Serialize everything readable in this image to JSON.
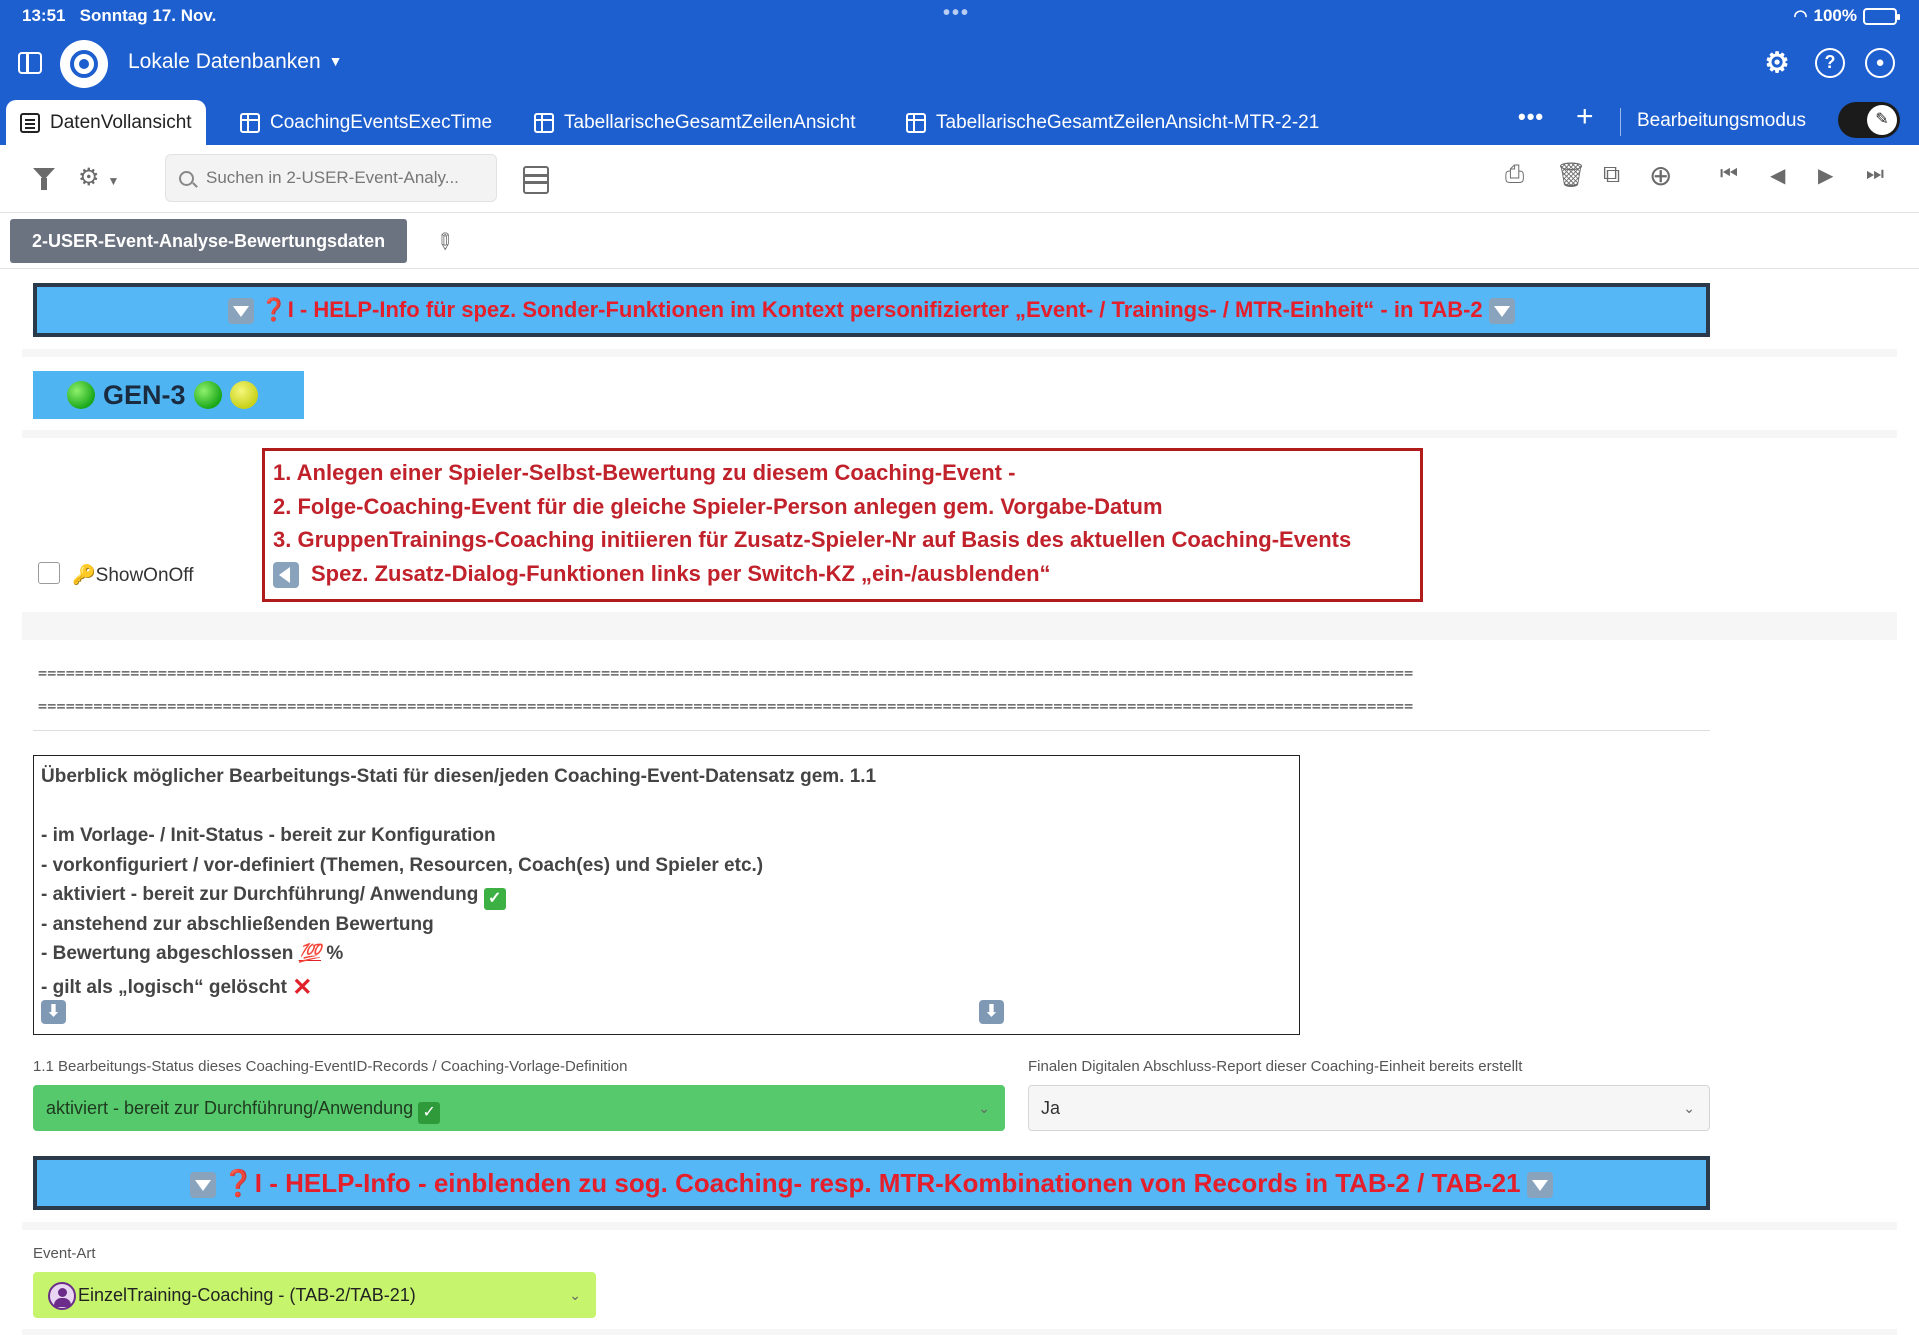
{
  "statusbar": {
    "time": "13:51",
    "date": "Sonntag 17. Nov.",
    "battery": "100%",
    "battery_level": 1.0
  },
  "header": {
    "database_title": "Lokale Datenbanken",
    "tabs": [
      {
        "label": "DatenVollansicht",
        "icon": "document-icon",
        "active": true
      },
      {
        "label": "CoachingEventsExecTime",
        "icon": "table-icon",
        "active": false
      },
      {
        "label": "TabellarischeGesamtZeilenAnsicht",
        "icon": "table-icon",
        "active": false
      },
      {
        "label": "TabellarischeGesamtZeilenAnsicht-MTR-2-21",
        "icon": "table-icon",
        "active": false
      }
    ],
    "edit_mode_label": "Bearbeitungsmodus",
    "edit_mode_on": true
  },
  "toolbar": {
    "search_placeholder": "Suchen in 2-USER-Event-Analy..."
  },
  "record": {
    "title": "2-USER-Event-Analyse-Bewertungsdaten"
  },
  "help_banner_1": "❓I - HELP-Info für spez. Sonder-Funktionen im Kontext personifizierter „Event- / Trainings- / MTR-Einheit“ - in TAB-2",
  "gen_label": "GEN-3",
  "show_toggle_label": "🔑ShowOnOff",
  "steps": [
    "1. Anlegen einer Spieler-Selbst-Bewertung zu diesem Coaching-Event -",
    "2. Folge-Coaching-Event für die gleiche Spieler-Person anlegen gem. Vorgabe-Datum",
    "3. GruppenTrainings-Coaching initiieren für Zusatz-Spieler-Nr auf Basis des aktuellen Coaching-Events",
    "Spez. Zusatz-Dialog-Funktionen links per Switch-KZ  „ein-/ausblenden“"
  ],
  "separator": "=====================================================================================================================================================",
  "status_overview": {
    "title": "Überblick möglicher Bearbeitungs-Stati für diesen/jeden Coaching-Event-Datensatz gem. 1.1",
    "items": [
      "- im Vorlage- / Init-Status - bereit zur Konfiguration",
      "- vorkonfiguriert / vor-definiert (Themen, Resourcen, Coach(es) und Spieler etc.)",
      "- aktiviert - bereit zur Durchführung/ Anwendung",
      "- anstehend zur abschließenden Bewertung",
      "- Bewertung abgeschlossen",
      "- gilt als „logisch“ gelöscht"
    ],
    "hundred_emoji": "💯",
    "percent": "%"
  },
  "fields": {
    "status_label": "1.1 Bearbeitungs-Status dieses Coaching-EventID-Records / Coaching-Vorlage-Definition",
    "status_value": "aktiviert - bereit zur Durchführung/Anwendung",
    "status_color": "#55c96b",
    "report_label": "Finalen Digitalen Abschluss-Report dieser Coaching-Einheit bereits erstellt",
    "report_value": "Ja",
    "event_type_label": "Event-Art",
    "event_type_value": "EinzelTraining-Coaching - (TAB-2/TAB-21)",
    "event_type_color": "#c6f56d"
  },
  "help_banner_2": "❓I - HELP-Info - einblenden zu sog. Coaching- resp. MTR-Kombinationen von Records in TAB-2 / TAB-21"
}
